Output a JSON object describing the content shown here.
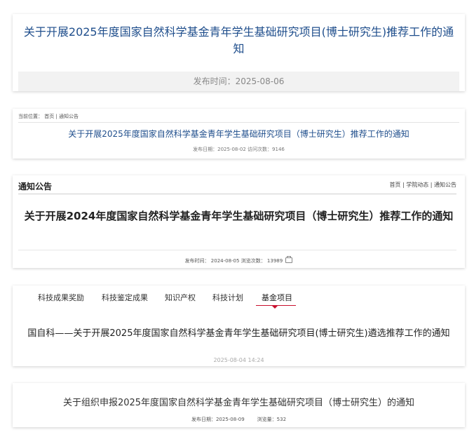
{
  "card1": {
    "title": "关于开展2025年度国家自然科学基金青年学生基础研究项目(博士研究生)推荐工作的通知",
    "publish_label": "发布时间：",
    "publish_date": "2025-08-06"
  },
  "card2": {
    "breadcrumb": "当前位置： 首页 | 通知公告",
    "title": "关于开展2025年度国家自然科学基金青年学生基础研究项目（博士研究生）推荐工作的通知",
    "meta": "发布日期：2025-08-02   访问次数：9146"
  },
  "card3": {
    "section_title": "通知公告",
    "breadcrumb": "首页 | 学院动态 | 通知公告",
    "title": "关于开展2024年度国家自然科学基金青年学生基础研究项目（博士研究生）推荐工作的通知",
    "meta": "发布时间： 2024-08-05  浏览次数： 13989"
  },
  "card4": {
    "tabs": [
      "科技成果奖励",
      "科技鉴定成果",
      "知识产权",
      "科技计划",
      "基金项目"
    ],
    "active_tab": "基金项目",
    "title": "国自科——关于开展2025年度国家自然科学基金青年学生基础研究项目(博士研究生)遴选推荐工作的通知",
    "date": "2025-08-04 14:24",
    "accent_color": "#c8102e"
  },
  "card5": {
    "title": "关于组织申报2025年度国家自然科学基金青年学生基础研究项目（博士研究生）的通知",
    "publish_date": "发布日期：2025-08-09",
    "views": "浏览量：532"
  }
}
